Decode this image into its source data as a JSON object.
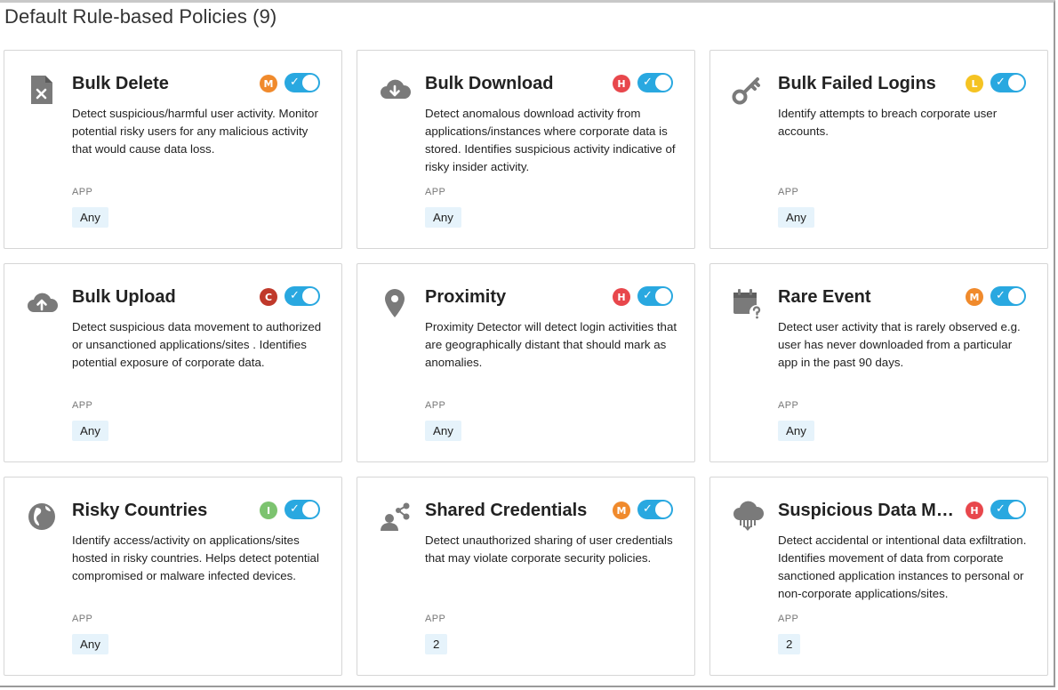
{
  "page": {
    "title": "Default Rule-based Policies (9)"
  },
  "colors": {
    "toggle_on": "#29a8e0",
    "severity_high": "#e8474c",
    "severity_medium": "#f08a2c",
    "severity_low": "#f5c322",
    "severity_critical": "#c0392b",
    "severity_info": "#7cc36f",
    "app_chip_bg": "#e6f3fb",
    "icon_gray": "#7a7a7a"
  },
  "policies": [
    {
      "title": "Bulk Delete",
      "icon": "file-delete-icon",
      "severity": "M",
      "severity_color": "#f08a2c",
      "enabled": true,
      "description": "Detect suspicious/harmful user activity. Monitor potential risky users for any malicious activity that would cause data loss.",
      "app_label": "APP",
      "app_value": "Any"
    },
    {
      "title": "Bulk Download",
      "icon": "cloud-download-icon",
      "severity": "H",
      "severity_color": "#e8474c",
      "enabled": true,
      "description": "Detect anomalous download activity from applications/instances where corporate data is stored. Identifies suspicious activity indicative of risky insider activity.",
      "app_label": "APP",
      "app_value": "Any"
    },
    {
      "title": "Bulk Failed Logins",
      "icon": "key-icon",
      "severity": "L",
      "severity_color": "#f5c322",
      "enabled": true,
      "description": "Identify attempts to breach corporate user accounts.",
      "app_label": "APP",
      "app_value": "Any"
    },
    {
      "title": "Bulk Upload",
      "icon": "cloud-upload-icon",
      "severity": "C",
      "severity_color": "#c0392b",
      "enabled": true,
      "description": "Detect suspicious data movement to authorized or unsanctioned applications/sites . Identifies potential exposure of corporate data.",
      "app_label": "APP",
      "app_value": "Any"
    },
    {
      "title": "Proximity",
      "icon": "map-pin-icon",
      "severity": "H",
      "severity_color": "#e8474c",
      "enabled": true,
      "description": "Proximity Detector will detect login activities that are geographically distant that should mark as anomalies.",
      "app_label": "APP",
      "app_value": "Any"
    },
    {
      "title": "Rare Event",
      "icon": "calendar-question-icon",
      "severity": "M",
      "severity_color": "#f08a2c",
      "enabled": true,
      "description": "Detect user activity that is rarely observed e.g. user has never downloaded from a particular app in the past 90 days.",
      "app_label": "APP",
      "app_value": "Any"
    },
    {
      "title": "Risky Countries",
      "icon": "globe-icon",
      "severity": "I",
      "severity_color": "#7cc36f",
      "enabled": true,
      "description": "Identify access/activity on applications/sites hosted in risky countries. Helps detect potential compromised or malware infected devices.",
      "app_label": "APP",
      "app_value": "Any"
    },
    {
      "title": "Shared Credentials",
      "icon": "user-share-icon",
      "severity": "M",
      "severity_color": "#f08a2c",
      "enabled": true,
      "description": "Detect unauthorized sharing of user credentials that may violate corporate security policies.",
      "app_label": "APP",
      "app_value": "2"
    },
    {
      "title": "Suspicious Data Mov...",
      "icon": "cloud-data-icon",
      "severity": "H",
      "severity_color": "#e8474c",
      "enabled": true,
      "description": "Detect accidental or intentional data exfiltration. Identifies movement of data from corporate sanctioned application instances to personal or non-corporate applications/sites.",
      "app_label": "APP",
      "app_value": "2"
    }
  ]
}
